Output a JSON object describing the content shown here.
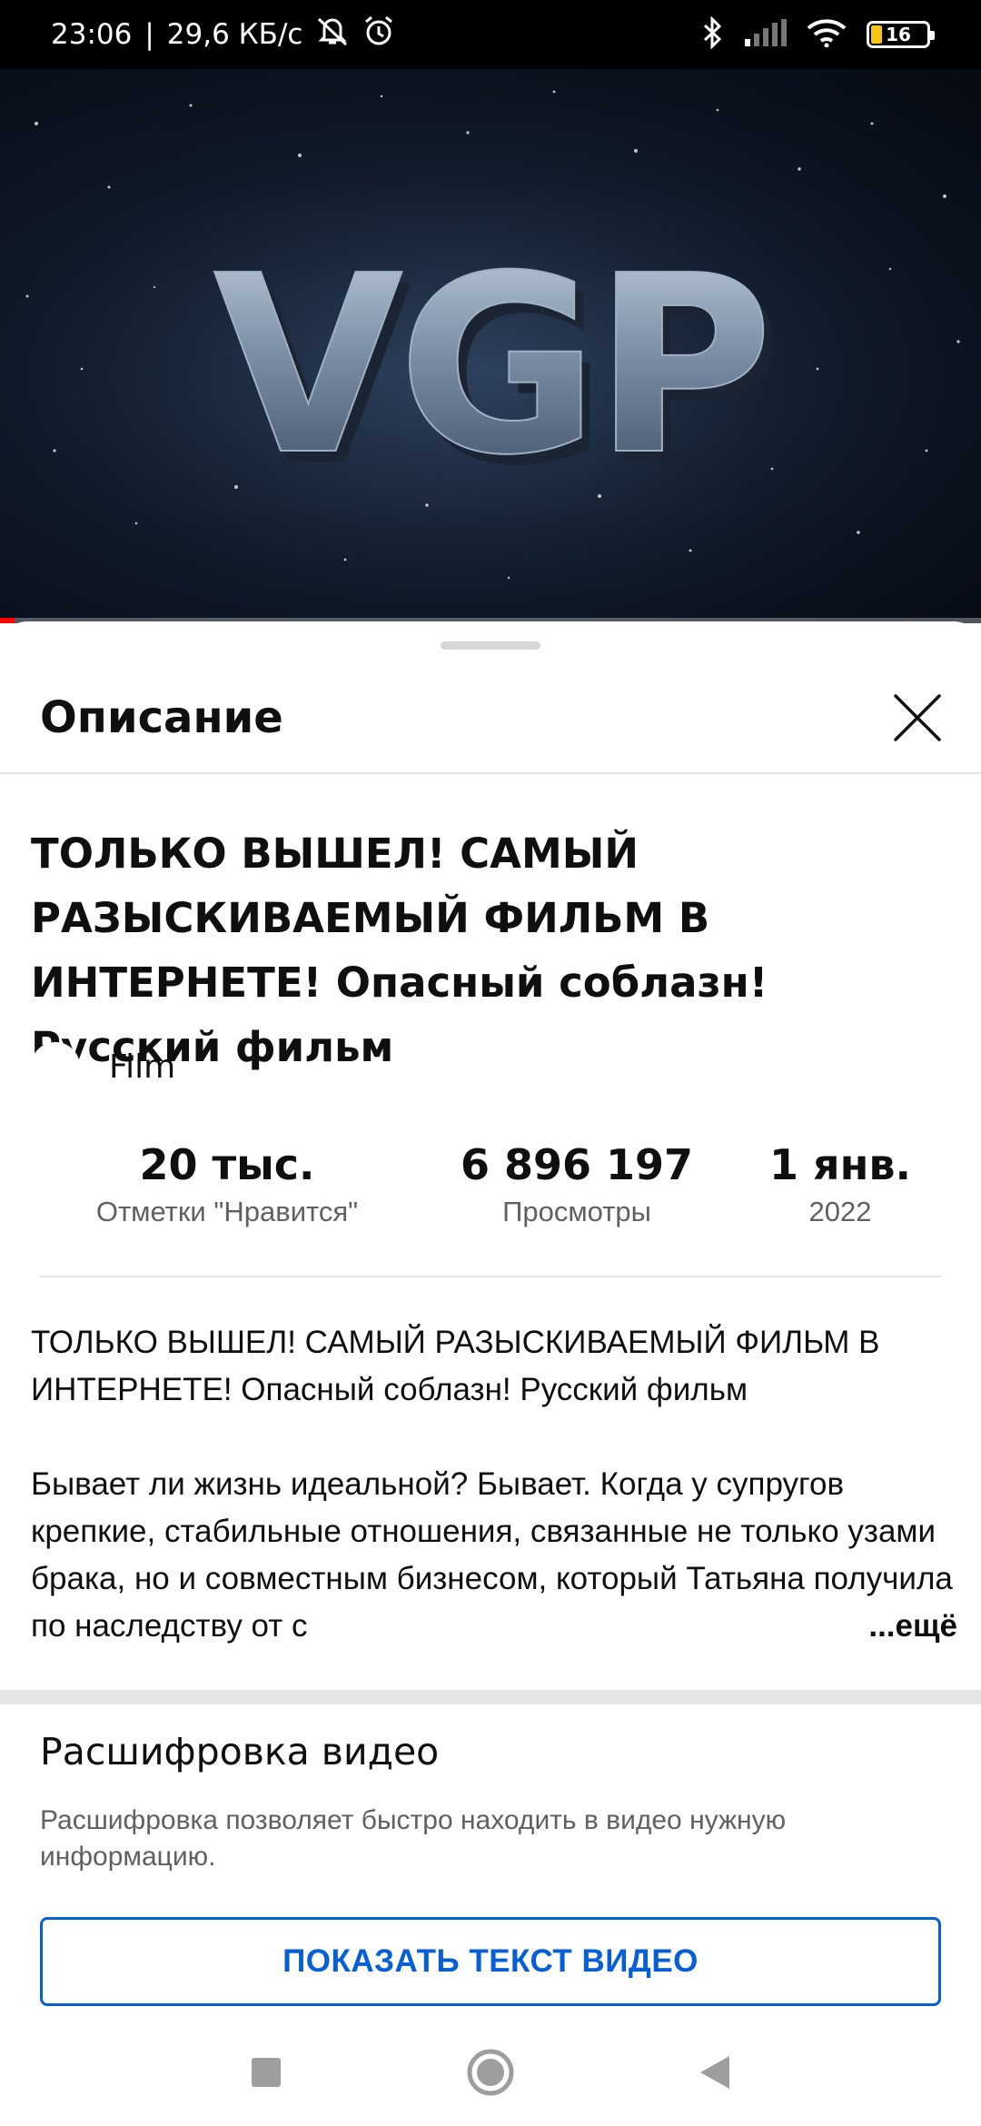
{
  "status_bar": {
    "time": "23:06",
    "separator": "|",
    "network_speed": "29,6 КБ/с",
    "battery_level": "16",
    "icons": [
      "mute-icon",
      "alarm-icon",
      "bluetooth-icon",
      "signal-icon",
      "wifi-icon",
      "battery-icon"
    ]
  },
  "video": {
    "logo_text": "VGP",
    "played_fraction": 0.015
  },
  "sheet": {
    "title": "Описание"
  },
  "video_info": {
    "title": "ТОЛЬКО ВЫШЕЛ! САМЫЙ РАЗЫСКИВАЕМЫЙ ФИЛЬМ В ИНТЕРНЕТЕ! Опасный соблазн! Русский фильм",
    "channel_name": "Film",
    "stats": [
      {
        "value": "20 тыс.",
        "label": "Отметки \"Нравится\""
      },
      {
        "value": "6 896 197",
        "label": "Просмотры"
      },
      {
        "value": "1 янв.",
        "label": "2022"
      }
    ]
  },
  "description": {
    "paragraph1": "ТОЛЬКО ВЫШЕЛ! САМЫЙ РАЗЫСКИВАЕМЫЙ ФИЛЬМ В ИНТЕРНЕТЕ! Опасный соблазн! Русский фильм",
    "paragraph2": "Бывает ли жизнь идеальной? Бывает. Когда у супругов крепкие, стабильные отношения, связанные не только узами брака, но и совместным бизнесом, который Татьяна получила по наследству от с",
    "more_label": "...ещё"
  },
  "transcript": {
    "title": "Расшифровка видео",
    "description": "Расшифровка позволяет быстро находить в видео нужную информацию.",
    "button_label": "ПОКАЗАТЬ ТЕКСТ ВИДЕО"
  },
  "nav": {
    "icons": [
      "recents-icon",
      "home-icon",
      "back-icon"
    ]
  },
  "colors": {
    "accent": "#065fd4",
    "progress": "#ff0000",
    "secondary_text": "#606060"
  }
}
